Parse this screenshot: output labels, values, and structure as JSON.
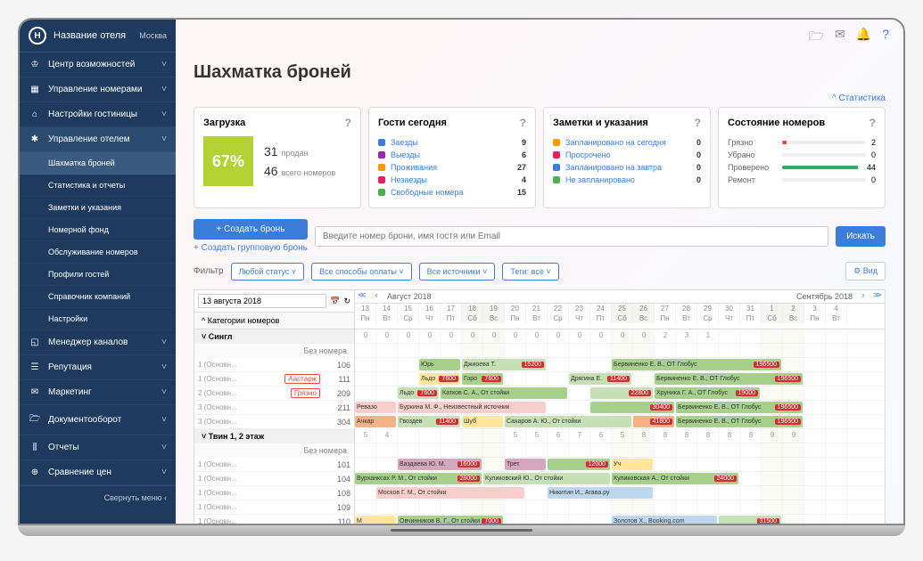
{
  "header": {
    "logo": "H",
    "hotel": "Название отеля",
    "city": "Москва"
  },
  "nav": [
    {
      "icon": "♔",
      "label": "Центр возможностей"
    },
    {
      "icon": "▦",
      "label": "Управление номерами"
    },
    {
      "icon": "⌂",
      "label": "Настройки гостиницы"
    },
    {
      "icon": "✱",
      "label": "Управление отелем",
      "active": true,
      "subs": [
        {
          "label": "Шахматка броней",
          "active": true
        },
        {
          "label": "Статистика и отчеты"
        },
        {
          "label": "Заметки и указания"
        },
        {
          "label": "Номерной фонд"
        },
        {
          "label": "Обслуживание номеров"
        },
        {
          "label": "Профили гостей"
        },
        {
          "label": "Справочник компаний"
        },
        {
          "label": "Настройки"
        }
      ]
    },
    {
      "icon": "◱",
      "label": "Менеджер каналов"
    },
    {
      "icon": "☰",
      "label": "Репутация"
    },
    {
      "icon": "✉",
      "label": "Маркетинг"
    },
    {
      "icon": "🗁",
      "label": "Документооборот"
    },
    {
      "icon": "⫼",
      "label": "Отчеты"
    },
    {
      "icon": "⊕",
      "label": "Сравнение цен"
    }
  ],
  "collapse": "Свернуть меню ‹",
  "page": {
    "title": "Шахматка броней",
    "stats": "^ Статистика"
  },
  "cards": {
    "occupancy": {
      "title": "Загрузка",
      "pct": "67%",
      "sold": "31",
      "sold_label": "продан",
      "total": "46",
      "total_label": "всего номеров"
    },
    "guests": {
      "title": "Гости сегодня",
      "rows": [
        {
          "color": "#3b7dd8",
          "label": "Заезды",
          "val": "9"
        },
        {
          "color": "#9c27b0",
          "label": "Выезды",
          "val": "6"
        },
        {
          "color": "#ff9800",
          "label": "Проживания",
          "val": "27"
        },
        {
          "color": "#e91e63",
          "label": "Незаезды",
          "val": "4"
        },
        {
          "color": "#4caf50",
          "label": "Свободные номера",
          "val": "15"
        }
      ]
    },
    "notes": {
      "title": "Заметки и указания",
      "rows": [
        {
          "color": "#ff9800",
          "label": "Запланировано на сегодня",
          "val": "0"
        },
        {
          "color": "#e91e63",
          "label": "Просрочено",
          "val": "0"
        },
        {
          "color": "#3b7dd8",
          "label": "Запланировано на завтра",
          "val": "0"
        },
        {
          "color": "#4caf50",
          "label": "Не запланировано",
          "val": "0"
        }
      ]
    },
    "rooms": {
      "title": "Состояние номеров",
      "rows": [
        {
          "label": "Грязно",
          "val": "2",
          "color": "#e74c3c",
          "pct": 5
        },
        {
          "label": "Убрано",
          "val": "0",
          "color": "#f39c12",
          "pct": 0
        },
        {
          "label": "Проверено",
          "val": "44",
          "color": "#27ae60",
          "pct": 95
        },
        {
          "label": "Ремонт",
          "val": "0",
          "color": "#95a5a6",
          "pct": 0
        }
      ]
    }
  },
  "actions": {
    "create": "+ Создать бронь",
    "group": "+ Создать групповую бронь",
    "search": "Введите номер брони, имя гостя или Email",
    "find": "Искать"
  },
  "filters": {
    "label": "Фильтр",
    "status": "Любой статус",
    "payment": "Все способы оплаты",
    "sources": "Все источники",
    "tags": "Теги: все",
    "view": "⚙ Вид"
  },
  "gantt": {
    "date": "13 августа 2018",
    "cat_header": "^ Категории номеров",
    "month1": "Август 2018",
    "month2": "Сентябрь 2018",
    "days": [
      {
        "n": "13",
        "w": "Пн"
      },
      {
        "n": "14",
        "w": "Вт"
      },
      {
        "n": "15",
        "w": "Ср"
      },
      {
        "n": "16",
        "w": "Чт"
      },
      {
        "n": "17",
        "w": "Пт"
      },
      {
        "n": "18",
        "w": "Сб",
        "we": true
      },
      {
        "n": "19",
        "w": "Вс",
        "we": true
      },
      {
        "n": "20",
        "w": "Пн"
      },
      {
        "n": "21",
        "w": "Вт"
      },
      {
        "n": "22",
        "w": "Ср"
      },
      {
        "n": "23",
        "w": "Чт"
      },
      {
        "n": "24",
        "w": "Пт"
      },
      {
        "n": "25",
        "w": "Сб",
        "we": true
      },
      {
        "n": "26",
        "w": "Вс",
        "we": true
      },
      {
        "n": "27",
        "w": "Пн"
      },
      {
        "n": "28",
        "w": "Вт"
      },
      {
        "n": "29",
        "w": "Ср"
      },
      {
        "n": "30",
        "w": "Чт"
      },
      {
        "n": "31",
        "w": "Пт"
      },
      {
        "n": "1",
        "w": "Сб",
        "we": true
      },
      {
        "n": "2",
        "w": "Вс",
        "we": true
      },
      {
        "n": "3",
        "w": "Пн"
      },
      {
        "n": "4",
        "w": "Вт"
      }
    ],
    "cats": [
      {
        "name": "Сингл",
        "avail": [
          "0",
          "0",
          "0",
          "0",
          "0",
          "0",
          "0",
          "0",
          "0",
          "0",
          "0",
          "0",
          "0",
          "0",
          "2",
          "3",
          "1",
          "",
          "",
          "",
          "",
          "",
          ""
        ],
        "rooms": [
          {
            "rate": "1 (Основн...",
            "num": "106",
            "bookings": [
              {
                "c": "green",
                "l": 3,
                "w": 2,
                "t": "Юрь"
              },
              {
                "c": "lgreen",
                "l": 5,
                "w": 4,
                "t": "Джиоева Т.",
                "p": "15200"
              },
              {
                "c": "green",
                "l": 12,
                "w": 8,
                "t": "Бервиненко Е. В., ОТ Глобус",
                "p": "196500"
              }
            ]
          },
          {
            "rate": "1 (Основн...",
            "num": "111",
            "status": "Аастарж",
            "bookings": [
              {
                "c": "yellow",
                "l": 3,
                "w": 2,
                "t": "Льдо",
                "p": "7600"
              },
              {
                "c": "green",
                "l": 5,
                "w": 2,
                "t": "Горо",
                "p": "7600"
              },
              {
                "c": "lgreen",
                "l": 10,
                "w": 3,
                "t": "Дрягина Е.",
                "p": "11400"
              },
              {
                "c": "green",
                "l": 14,
                "w": 7,
                "t": "Бервиненко Е. В., ОТ Глобус",
                "p": "196500"
              }
            ]
          },
          {
            "rate": "2 (Основн...",
            "num": "209",
            "status": "Грязно",
            "bookings": [
              {
                "c": "lgreen",
                "l": 2,
                "w": 2,
                "t": "Льдо",
                "p": "7600"
              },
              {
                "c": "green",
                "l": 4,
                "w": 6,
                "t": "Катков С. А., От стойки"
              },
              {
                "c": "lgreen",
                "l": 11,
                "w": 3,
                "t": "",
                "p": "22800"
              },
              {
                "c": "green",
                "l": 14,
                "w": 5,
                "t": "Хруника Г. А., ОТ Глобус",
                "p": "19000"
              }
            ]
          },
          {
            "rate": "3 (Основн...",
            "num": "211",
            "bookings": [
              {
                "c": "pink",
                "l": 0,
                "w": 2,
                "t": "Ревазо"
              },
              {
                "c": "pink",
                "l": 2,
                "w": 7,
                "t": "Буркина М. Ф., Неизвестный источник"
              },
              {
                "c": "green",
                "l": 11,
                "w": 4,
                "t": "",
                "p": "30400"
              },
              {
                "c": "green",
                "l": 15,
                "w": 6,
                "t": "Бервиненко Е. В., ОТ Глобус",
                "p": "196500"
              }
            ]
          },
          {
            "rate": "3 (Основн...",
            "num": "304",
            "bookings": [
              {
                "c": "orange",
                "l": 0,
                "w": 2,
                "t": "Ачкар"
              },
              {
                "c": "lgreen",
                "l": 2,
                "w": 3,
                "t": "Гвоздев",
                "p": "11400"
              },
              {
                "c": "yellow",
                "l": 5,
                "w": 2,
                "t": "Шуб"
              },
              {
                "c": "lgreen",
                "l": 7,
                "w": 6,
                "t": "Сахаров А. Ю., От стойки"
              },
              {
                "c": "orange",
                "l": 13,
                "w": 2,
                "t": "",
                "p": "41800"
              },
              {
                "c": "green",
                "l": 15,
                "w": 6,
                "t": "Бервиненко Е. В., ОТ Глобус",
                "p": "196500"
              }
            ]
          }
        ]
      },
      {
        "name": "Твин 1, 2 этаж",
        "avail": [
          "5",
          "4",
          "",
          "",
          "",
          "",
          "",
          "5",
          "5",
          "6",
          "7",
          "6",
          "5",
          "8",
          "8",
          "8",
          "8",
          "8",
          "8",
          "9",
          "9",
          "",
          ""
        ],
        "rooms": [
          {
            "rate": "1 (Основн...",
            "num": "101",
            "bookings": [
              {
                "c": "purple",
                "l": 2,
                "w": 4,
                "t": "Ваздаева Ю. М.",
                "p": "16000"
              },
              {
                "c": "purple",
                "l": 7,
                "w": 2,
                "t": "Трет"
              },
              {
                "c": "green",
                "l": 9,
                "w": 3,
                "t": "",
                "p": "12000"
              },
              {
                "c": "yellow",
                "l": 12,
                "w": 2,
                "t": "Уч"
              }
            ]
          },
          {
            "rate": "1 (Основн...",
            "num": "104",
            "bookings": [
              {
                "c": "green",
                "l": 0,
                "w": 6,
                "t": "Вурханксах Р. М., От стойки",
                "p": "28000"
              },
              {
                "c": "lgreen",
                "l": 6,
                "w": 6,
                "t": "Куликовский Ю., От стойки"
              },
              {
                "c": "green",
                "l": 12,
                "w": 6,
                "t": "Куликовская А., От стойки",
                "p": "24000"
              }
            ]
          },
          {
            "rate": "1 (Основн...",
            "num": "108",
            "bookings": [
              {
                "c": "pink",
                "l": 1,
                "w": 7,
                "t": "Москов Г. М., От стойки"
              },
              {
                "c": "blue",
                "l": 9,
                "w": 5,
                "t": "Никитин И., Агава.ру"
              }
            ]
          },
          {
            "rate": "1 (Основн...",
            "num": "109",
            "bookings": []
          },
          {
            "rate": "1 (Основн...",
            "num": "110",
            "bookings": [
              {
                "c": "yellow",
                "l": 0,
                "w": 2,
                "t": "М"
              },
              {
                "c": "green",
                "l": 2,
                "w": 5,
                "t": "Овчинников В. Г., От стойки",
                "p": "7000"
              },
              {
                "c": "blue",
                "l": 12,
                "w": 5,
                "t": "Золотов Х., Booking.com"
              },
              {
                "c": "lgreen",
                "l": 17,
                "w": 3,
                "t": "",
                "p": "31500"
              }
            ]
          }
        ]
      }
    ]
  }
}
